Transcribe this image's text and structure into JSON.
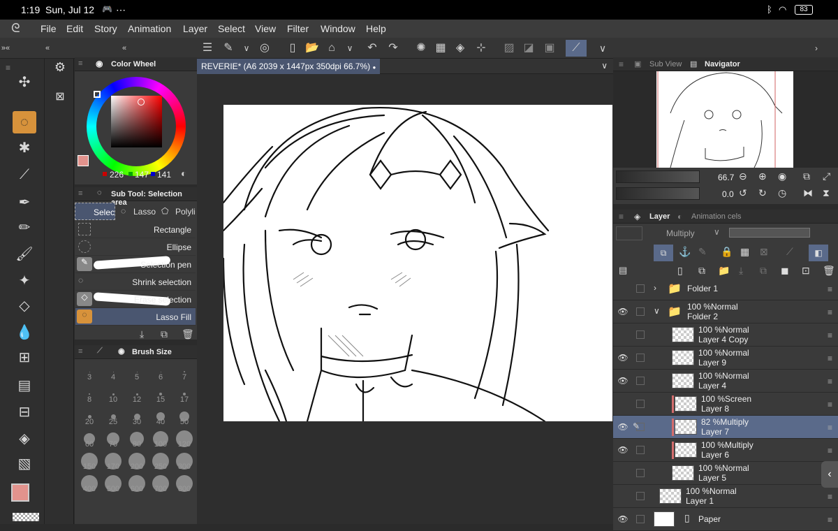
{
  "status": {
    "time": "1:19",
    "date": "Sun, Jul 12",
    "battery": "83"
  },
  "menu": [
    "File",
    "Edit",
    "Story",
    "Animation",
    "Layer",
    "Select",
    "View",
    "Filter",
    "Window",
    "Help"
  ],
  "color_wheel": {
    "title": "Color Wheel",
    "r": "226",
    "g": "147",
    "b": "141",
    "main_color": "#e2938d"
  },
  "sub_tool": {
    "title": "Sub Tool: Selection area",
    "tabs": [
      "Selec",
      "Lasso",
      "Polyli"
    ],
    "items": [
      "Rectangle",
      "Ellipse",
      "Selection pen",
      "Shrink selection",
      "Erase selection",
      "Lasso Fill"
    ]
  },
  "brush_size": {
    "title": "Brush Size",
    "sizes": [
      "3",
      "4",
      "5",
      "6",
      "7",
      "8",
      "10",
      "12",
      "15",
      "17",
      "20",
      "25",
      "30",
      "40",
      "50",
      "60",
      "70",
      "80",
      "100",
      "120",
      "150",
      "170",
      "200",
      "250",
      "300",
      "400",
      "500",
      "600",
      "700",
      "800"
    ]
  },
  "document": {
    "tab_label": "REVERIE* (A6 2039 x 1447px 350dpi 66.7%)"
  },
  "navigator": {
    "sub_view": "Sub View",
    "navigator": "Navigator",
    "zoom": "66.7",
    "rotate": "0.0"
  },
  "layer_panel": {
    "tab_layer": "Layer",
    "tab_anim": "Animation cels",
    "blend_mode": "Multiply",
    "layers": [
      {
        "line1": "",
        "line2": "Folder 1",
        "visible": false,
        "folder": true,
        "indent": 0,
        "collapsed": true
      },
      {
        "line1": "100 %Normal",
        "line2": "Folder 2",
        "visible": true,
        "folder": true,
        "indent": 0,
        "collapsed": false
      },
      {
        "line1": "100 %Normal",
        "line2": "Layer 4 Copy",
        "visible": false,
        "indent": 1
      },
      {
        "line1": "100 %Normal",
        "line2": "Layer 9",
        "visible": true,
        "indent": 1
      },
      {
        "line1": "100 %Normal",
        "line2": "Layer 4",
        "visible": true,
        "indent": 1
      },
      {
        "line1": "100 %Screen",
        "line2": "Layer 8",
        "visible": false,
        "indent": 1,
        "clip": true
      },
      {
        "line1": "82 %Multiply",
        "line2": "Layer 7",
        "visible": true,
        "indent": 1,
        "clip": true,
        "selected": true
      },
      {
        "line1": "100 %Multiply",
        "line2": "Layer 6",
        "visible": true,
        "indent": 1,
        "clip": true
      },
      {
        "line1": "100 %Normal",
        "line2": "Layer 5",
        "visible": false,
        "indent": 1
      },
      {
        "line1": "100 %Normal",
        "line2": "Layer 1",
        "visible": false,
        "indent": 0
      },
      {
        "line1": "",
        "line2": "Paper",
        "visible": true,
        "indent": 0,
        "paper": true
      }
    ]
  }
}
